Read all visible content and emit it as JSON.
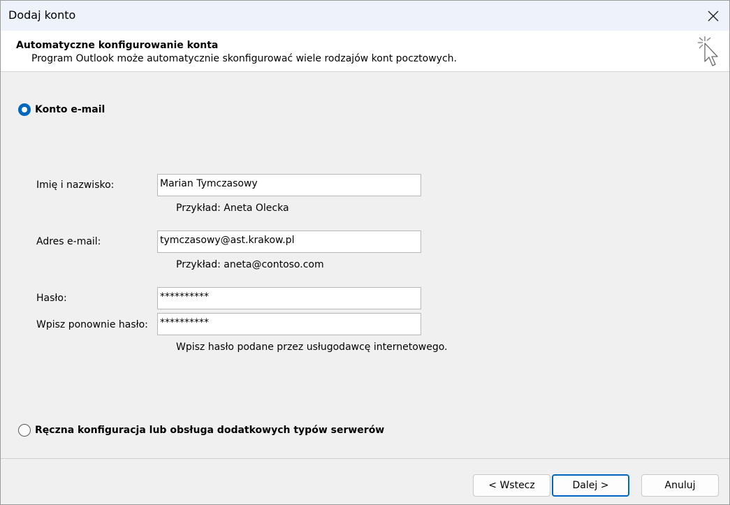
{
  "window": {
    "title": "Dodaj konto"
  },
  "header": {
    "title": "Automatyczne konfigurowanie konta",
    "subtitle": "Program Outlook może automatycznie skonfigurować wiele rodzajów kont pocztowych."
  },
  "option_email": {
    "label": "Konto e-mail",
    "selected": true
  },
  "form": {
    "name": {
      "label": "Imię i nazwisko:",
      "value": "Marian Tymczasowy",
      "hint": "Przykład: Aneta Olecka"
    },
    "email": {
      "label": "Adres e-mail:",
      "value": "tymczasowy@ast.krakow.pl",
      "hint": "Przykład: aneta@contoso.com"
    },
    "password": {
      "label": "Hasło:",
      "value": "**********"
    },
    "password_confirm": {
      "label": "Wpisz ponownie hasło:",
      "value": "**********",
      "hint": "Wpisz hasło podane przez usługodawcę internetowego."
    }
  },
  "option_manual": {
    "label": "Ręczna konfiguracja lub obsługa dodatkowych typów serwerów",
    "selected": false
  },
  "buttons": {
    "back": "< Wstecz",
    "next": "Dalej >",
    "cancel": "Anuluj"
  },
  "icons": {
    "close": "close-icon",
    "wizard": "cursor-sparkle-icon"
  },
  "colors": {
    "accent": "#0067c0"
  }
}
